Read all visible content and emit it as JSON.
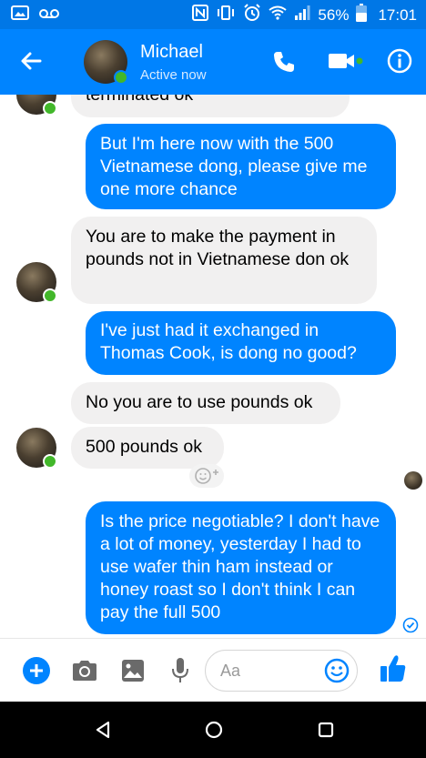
{
  "status_bar": {
    "battery": "56%",
    "time": "17:01"
  },
  "header": {
    "name": "Michael",
    "status": "Active now"
  },
  "messages": [
    {
      "from": "them",
      "text": "terminated ok"
    },
    {
      "from": "me",
      "text": "But I'm here now with the 500 Vietnamese dong, please give me one more chance"
    },
    {
      "from": "them",
      "text": "You are to make the payment in pounds not in Vietnamese don ok"
    },
    {
      "from": "me",
      "text": "I've just had it exchanged in Thomas Cook, is dong no good?"
    },
    {
      "from": "them",
      "text": "No you are to use pounds ok"
    },
    {
      "from": "them",
      "text": "500 pounds ok"
    },
    {
      "from": "me",
      "text": "Is the price negotiable? I don't have a lot of money, yesterday I had to use wafer thin ham instead or honey roast so I don't think I can pay the full 500"
    }
  ],
  "composer": {
    "placeholder": "Aa"
  },
  "colors": {
    "brand": "#0084ff",
    "status_bar": "#0077e6",
    "incoming_bubble": "#f1f0f0",
    "online": "#42b72a"
  },
  "icons": [
    "voicemail-icon",
    "image-icon",
    "nfc-icon",
    "vibrate-icon",
    "alarm-icon",
    "wifi-icon",
    "signal-icon",
    "battery-icon",
    "back-arrow-icon",
    "phone-icon",
    "video-camera-icon",
    "info-icon",
    "plus-icon",
    "camera-icon",
    "gallery-icon",
    "microphone-icon",
    "emoji-icon",
    "thumbs-up-icon",
    "add-reaction-icon",
    "delivered-check-icon",
    "nav-back-icon",
    "nav-home-icon",
    "nav-recents-icon"
  ]
}
